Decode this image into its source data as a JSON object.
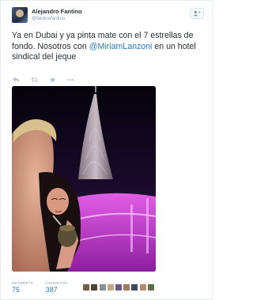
{
  "tweet": {
    "display_name": "Alejandro Fantino",
    "screen_name": "@fantinofantino",
    "text_part1": "Ya en Dubai y ya pinta mate con el 7 estrellas de fondo. Nosotros con ",
    "mention": "@MiriamLanzoni",
    "text_part2": " en un hotel sindical  del jeque"
  },
  "actions": {
    "icons": [
      "reply-icon",
      "retweet-icon",
      "favorite-icon",
      "more-icon"
    ]
  },
  "follow_button": {
    "icon": "follow-user-icon"
  },
  "stats": {
    "retweets_label": "RETWEETS",
    "retweets_value": "75",
    "favorites_label": "FAVORITOS",
    "favorites_value": "387"
  },
  "favoriters": {
    "colors": [
      "#7a5a48",
      "#4b4236",
      "#8a8f94",
      "#c2a98a",
      "#6b5a7c",
      "#9e7a62",
      "#3d4a5c",
      "#b48a72",
      "#5c6f4a"
    ]
  },
  "colors": {
    "link": "#2b7bb9",
    "muted": "#8899a6",
    "photo_glow": "#d23cdc"
  }
}
